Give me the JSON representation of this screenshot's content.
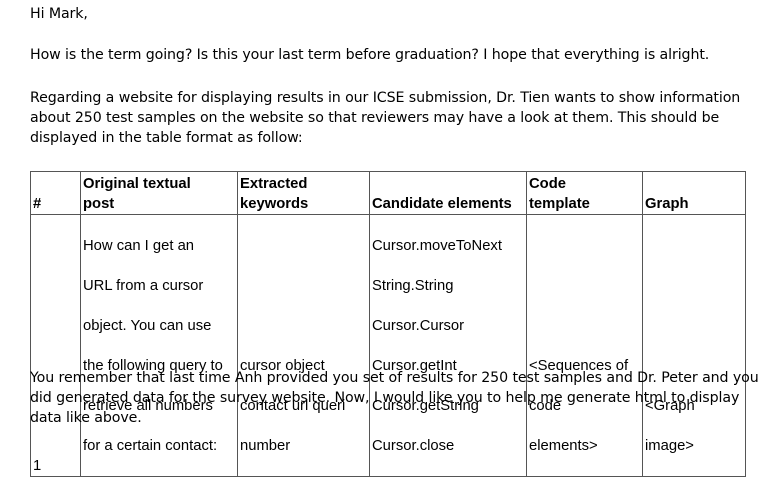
{
  "greeting": "Hi Mark,",
  "question": "How is the term going? Is this your last term before graduation? I hope that everything is alright.",
  "request": "Regarding a website for displaying results in our ICSE submission, Dr. Tien wants to show information about 250 test samples on the website so that reviewers may have a look at them. This should be displayed in the table format as follow:",
  "table": {
    "headers": {
      "num": "#",
      "post": "Original textual\npost",
      "keywords": "Extracted\nkeywords",
      "candidates": "Candidate elements",
      "code": "Code\ntemplate",
      "graph": "Graph"
    },
    "row": {
      "num": "1",
      "post": [
        "How can I get an",
        "URL from a cursor",
        "object. You can use",
        "the following query to",
        "retrieve all numbers",
        "for a certain contact:"
      ],
      "keywords": [
        "cursor object",
        "contact url queri",
        "number"
      ],
      "candidates": [
        "Cursor.moveToNext",
        "String.String",
        "Cursor.Cursor",
        "Cursor.getInt",
        "Cursor.getString",
        "Cursor.close"
      ],
      "code": [
        "<Sequences of",
        "code",
        "elements>"
      ],
      "graph": [
        "<Graph",
        "image>"
      ]
    }
  },
  "closing": "You remember that last time Anh provided you set of results for 250 test samples and Dr. Peter and you did generated data for the survey website. Now, I would like you to help me generate html to display data like above."
}
